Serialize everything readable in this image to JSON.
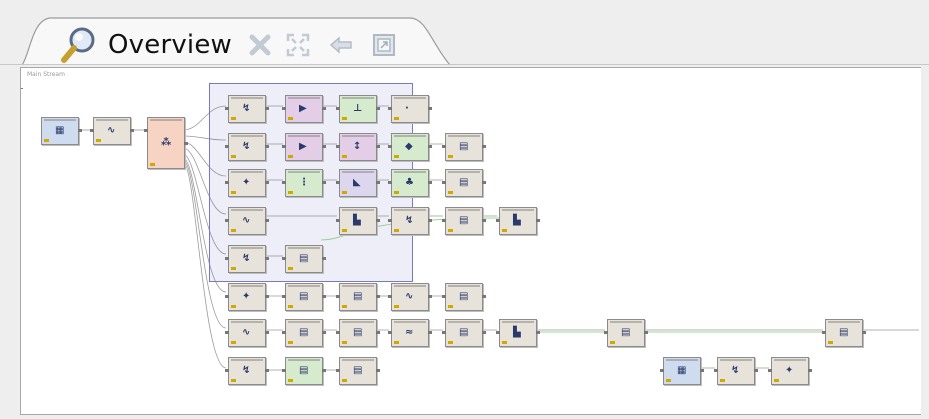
{
  "tab": {
    "title": "Overview",
    "icons": [
      "search-icon",
      "close-icon",
      "fit-screen-icon",
      "back-icon",
      "export-icon"
    ]
  },
  "canvas": {
    "label": "Main Stream",
    "node_colors": {
      "gray": "#e8e3da",
      "pink": "#e4cde6",
      "green": "#d6ebcd",
      "salmon": "#f7d3c4",
      "blue": "#cfdbef",
      "lavender": "#ddd6ef"
    },
    "node_glyphs": [
      "bar-chart-icon",
      "filter-icon",
      "play-icon",
      "table-icon",
      "star-icon",
      "arrow-icon"
    ]
  }
}
